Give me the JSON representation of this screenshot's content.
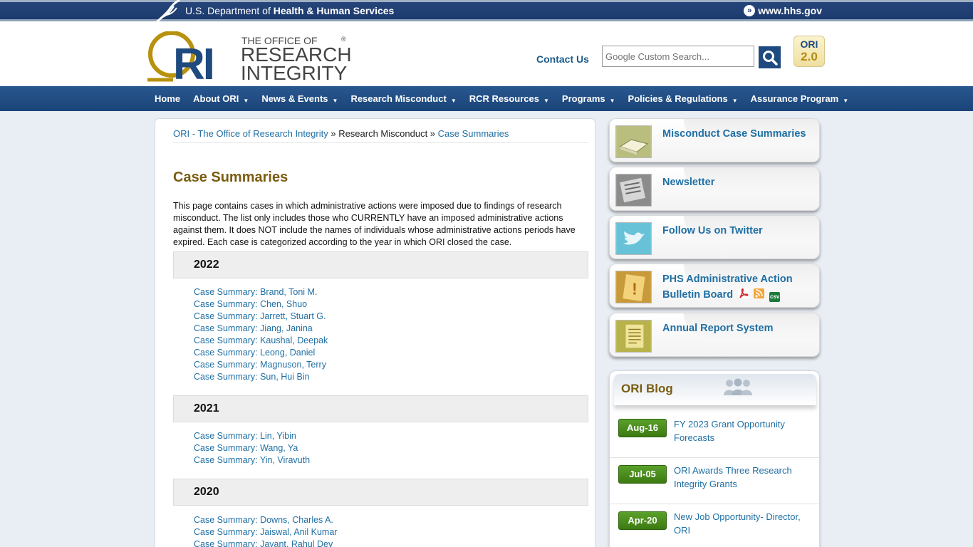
{
  "hhs": {
    "dept_prefix": "U.S. Department of ",
    "dept_name": "Health & Human Services",
    "site_link": "www.hhs.gov"
  },
  "header": {
    "logo_alt": "ORI - The Office of Research Integrity",
    "logo_line1": "THE OFFICE OF",
    "logo_line2": "RESEARCH",
    "logo_line3": "INTEGRITY",
    "contact": "Contact Us",
    "search_placeholder": "Google Custom Search...",
    "badge_top": "ORI",
    "badge_bottom": "2.0"
  },
  "nav": [
    {
      "label": "Home",
      "dropdown": false
    },
    {
      "label": "About ORI",
      "dropdown": true
    },
    {
      "label": "News & Events",
      "dropdown": true
    },
    {
      "label": "Research Misconduct",
      "dropdown": true
    },
    {
      "label": "RCR Resources",
      "dropdown": true
    },
    {
      "label": "Programs",
      "dropdown": true
    },
    {
      "label": "Policies & Regulations",
      "dropdown": true
    },
    {
      "label": "Assurance Program",
      "dropdown": true
    }
  ],
  "breadcrumb": {
    "home": "ORI - The Office of Research Integrity",
    "sep": " » ",
    "middle": "Research Misconduct",
    "current": "Case Summaries"
  },
  "main": {
    "title": "Case Summaries",
    "intro": "This page contains cases in which administrative actions were imposed due to findings of research misconduct. The list only includes those who CURRENTLY have an imposed administrative actions against them. It does NOT include the names of individuals whose administrative actions periods have expired. Each case is categorized according to the year in which ORI closed the case.",
    "years": [
      {
        "year": "2022",
        "cases": [
          "Case Summary: Brand, Toni M.",
          "Case Summary: Chen, Shuo",
          "Case Summary: Jarrett, Stuart G.",
          "Case Summary: Jiang, Janina",
          "Case Summary: Kaushal, Deepak",
          "Case Summary: Leong, Daniel",
          "Case Summary: Magnuson, Terry",
          "Case Summary: Sun, Hui Bin"
        ]
      },
      {
        "year": "2021",
        "cases": [
          "Case Summary: Lin, Yibin",
          "Case Summary: Wang, Ya",
          "Case Summary: Yin, Viravuth"
        ]
      },
      {
        "year": "2020",
        "cases": [
          "Case Summary: Downs, Charles A.",
          "Case Summary: Jaiswal, Anil Kumar",
          "Case Summary: Jayant, Rahul Dev"
        ]
      }
    ]
  },
  "sidebar": {
    "cards": [
      {
        "label": "Misconduct Case Summaries",
        "icon": "book-icon"
      },
      {
        "label": "Newsletter",
        "icon": "newsletter-icon"
      },
      {
        "label": "Follow Us on Twitter",
        "icon": "twitter-icon"
      },
      {
        "label_line1": "PHS Administrative Action",
        "label_line2": "Bulletin Board",
        "icon": "bulletin-icon",
        "formats": [
          "pdf",
          "rss",
          "csv"
        ]
      },
      {
        "label": "Annual Report System",
        "icon": "report-icon"
      }
    ],
    "blog": {
      "title": "ORI Blog",
      "items": [
        {
          "date": "Aug-16",
          "title": "FY 2023 Grant Opportunity Forecasts"
        },
        {
          "date": "Jul-05",
          "title": "ORI Awards Three Research Integrity Grants"
        },
        {
          "date": "Apr-20",
          "title": "New Job Opportunity- Director, ORI"
        }
      ]
    }
  },
  "colors": {
    "nav_bg": "#1e4a80",
    "link": "#1f6fa4",
    "heading_gold": "#7a5c10",
    "blog_date_green": "#4a8c1c"
  }
}
